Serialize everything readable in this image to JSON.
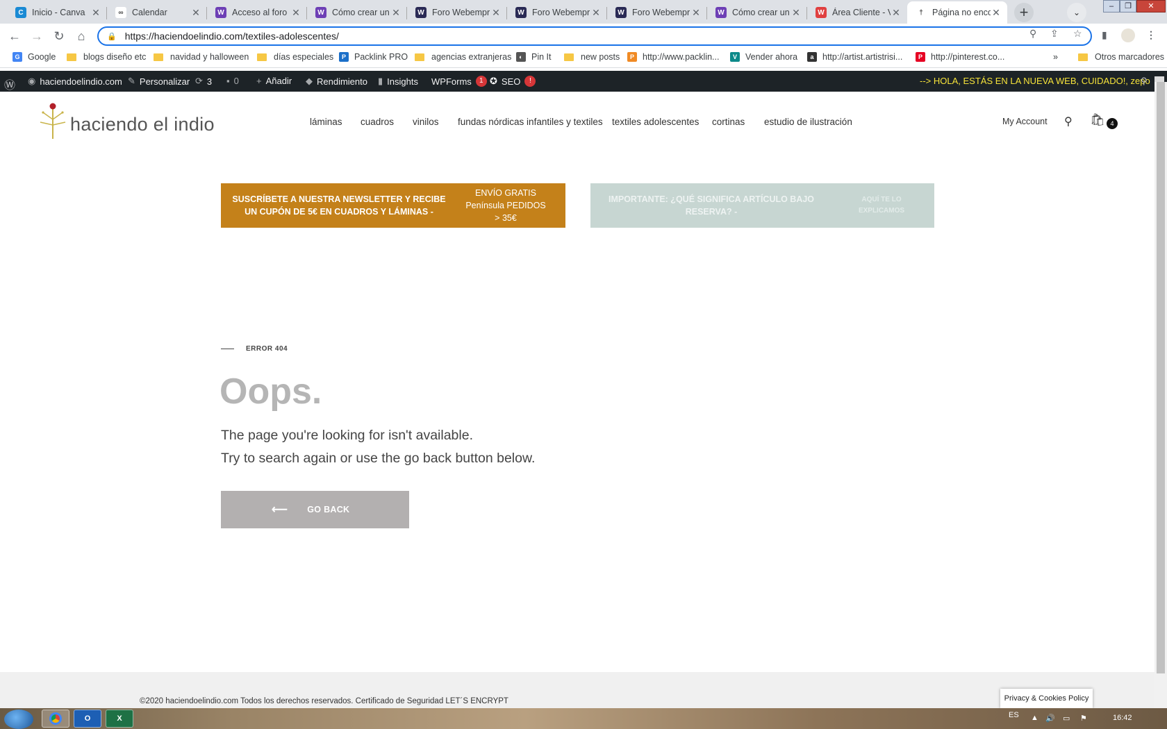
{
  "browser": {
    "tabs": [
      {
        "title": "Inicio - Canva",
        "fav": "canva-icon",
        "color": "#1a8ad4",
        "glyph": "C"
      },
      {
        "title": "Calendar",
        "fav": "infinity-icon",
        "color": "#ffffff",
        "glyph": "∞"
      },
      {
        "title": "Acceso al foro",
        "fav": "webempresa-icon",
        "color": "#6d3fb5",
        "glyph": "W"
      },
      {
        "title": "Cómo crear un",
        "fav": "webempresa-icon",
        "color": "#6d3fb5",
        "glyph": "W"
      },
      {
        "title": "Foro Webempr",
        "fav": "webempresa-icon",
        "color": "#2a2a55",
        "glyph": "W"
      },
      {
        "title": "Foro Webempr",
        "fav": "webempresa-icon",
        "color": "#2a2a55",
        "glyph": "W"
      },
      {
        "title": "Foro Webempr",
        "fav": "webempresa-icon",
        "color": "#2a2a55",
        "glyph": "W"
      },
      {
        "title": "Cómo crear un",
        "fav": "webempresa-icon",
        "color": "#6d3fb5",
        "glyph": "W"
      },
      {
        "title": "Área Cliente - V",
        "fav": "webempresa-client-icon",
        "color": "#e04040",
        "glyph": "W"
      },
      {
        "title": "Página no enco",
        "fav": "site-logo-icon",
        "color": "#ffffff",
        "glyph": "†"
      }
    ],
    "url": "https://haciendoelindio.com/textiles-adolescentes/",
    "bookmarks": [
      {
        "label": "Google",
        "type": "site",
        "color": "#4285f4",
        "glyph": "G"
      },
      {
        "label": "blogs diseño etc",
        "type": "folder"
      },
      {
        "label": "navidad y halloween",
        "type": "folder"
      },
      {
        "label": "días especiales",
        "type": "folder"
      },
      {
        "label": "Packlink PRO",
        "type": "site",
        "color": "#1b6fc9",
        "glyph": "P"
      },
      {
        "label": "agencias extranjeras",
        "type": "folder"
      },
      {
        "label": "Pin It",
        "type": "site",
        "color": "#555555",
        "glyph": "◐"
      },
      {
        "label": "new posts",
        "type": "folder"
      },
      {
        "label": "http://www.packlin...",
        "type": "site",
        "color": "#f08a24",
        "glyph": "P"
      },
      {
        "label": "Vender ahora",
        "type": "site",
        "color": "#0d8a8a",
        "glyph": "V"
      },
      {
        "label": "http://artist.artistrisi...",
        "type": "site",
        "color": "#333333",
        "glyph": "a"
      },
      {
        "label": "http://pinterest.co...",
        "type": "site",
        "color": "#e60023",
        "glyph": "P"
      }
    ],
    "bookmarks_more": "»",
    "other_bookmarks": "Otros marcadores"
  },
  "adminbar": {
    "site": "haciendoelindio.com",
    "customize": "Personalizar",
    "updates": "3",
    "comments": "0",
    "add": "Añadir",
    "performance": "Rendimiento",
    "insights": "Insights",
    "wpforms": "WPForms",
    "wpforms_badge": "1",
    "seo": "SEO",
    "seo_badge": "!",
    "notice": "--> HOLA, ESTÁS EN LA NUEVA WEB, CUIDADO!, zepo"
  },
  "site": {
    "logo": "haciendo el indio",
    "nav": [
      "láminas",
      "cuadros",
      "vinilos",
      "fundas nórdicas infantiles y textiles",
      "textiles adolescentes",
      "cortinas",
      "estudio de ilustración"
    ],
    "my_account": "My Account",
    "cart_count": "4",
    "promo_left_1": "SUSCRÍBETE A NUESTRA NEWSLETTER Y RECIBE UN CUPÓN DE 5€ EN CUADROS Y LÁMINAS -",
    "promo_left_2": "ENVÍO GRATIS Península PEDIDOS > 35€",
    "promo_right_1": "IMPORTANTE: ¿QUÉ SIGNIFICA ARTÍCULO BAJO RESERVA? -",
    "promo_right_2": "AQUÍ TE LO EXPLICAMOS",
    "error_label": "ERROR 404",
    "heading": "Oops.",
    "message_1": "The page you're looking for isn't available.",
    "message_2": "Try to search again or use the go back button below.",
    "go_back": "GO BACK",
    "footer": "©2020 haciendoelindio.com Todos los derechos reservados. Certificado de Seguridad LET´S ENCRYPT",
    "privacy": "Privacy & Cookies Policy"
  },
  "taskbar": {
    "lang": "ES",
    "time": "16:42"
  },
  "colors": {
    "promo_orange": "#c4811a",
    "promo_grey": "#c7d6d2",
    "adminbar": "#1d2327",
    "notice": "#f7e43a",
    "goback": "#b3b0b0"
  }
}
